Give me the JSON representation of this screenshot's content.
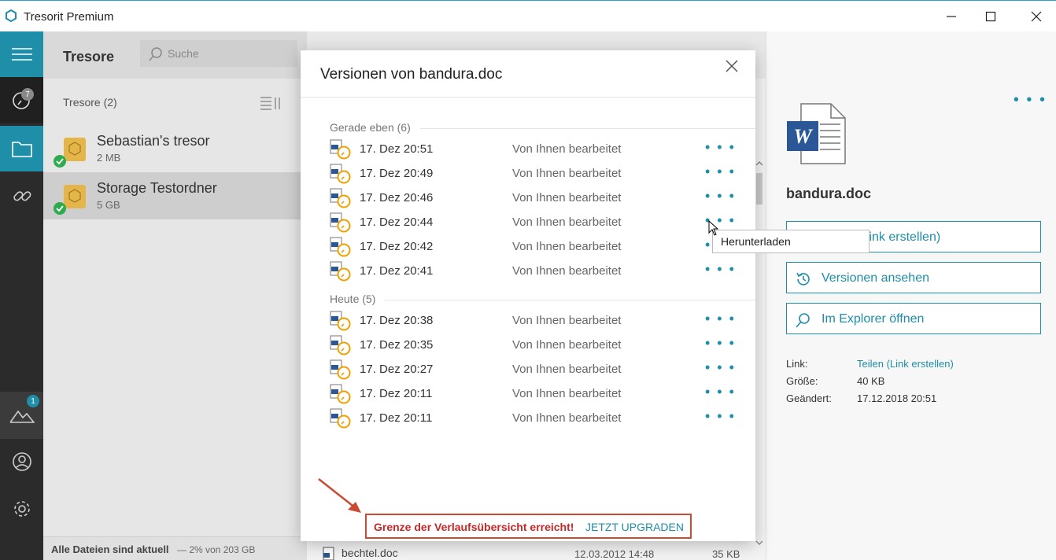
{
  "window": {
    "title": "Tresorit Premium"
  },
  "sidebar": {
    "recents_badge": "7",
    "upgrade_badge": "1"
  },
  "panel": {
    "title": "Tresore",
    "search_placeholder": "Suche",
    "count": "Tresore (2)",
    "vaults": [
      {
        "name": "Sebastian's tresor",
        "size": "2 MB"
      },
      {
        "name": "Storage Testordner",
        "size": "5 GB"
      }
    ],
    "footer_status": "Alle Dateien sind aktuell",
    "footer_quota": "— 2% von 203 GB"
  },
  "background_file": {
    "name": "bechtel.doc",
    "date": "12.03.2012 14:48",
    "size": "35 KB"
  },
  "details": {
    "file_name": "bandura.doc",
    "btn_share": "Teilen (Link erstellen)",
    "btn_versions": "Versionen ansehen",
    "btn_explorer": "Im Explorer öffnen",
    "link_label": "Link:",
    "link_value": "Teilen (Link erstellen)",
    "size_label": "Größe:",
    "size_value": "40 KB",
    "changed_label": "Geändert:",
    "changed_value": "17.12.2018 20:51"
  },
  "dialog": {
    "title": "Versionen von bandura.doc",
    "groups": [
      {
        "label": "Gerade eben (6)",
        "rows": [
          {
            "date": "17. Dez 20:51",
            "by": "Von Ihnen bearbeitet"
          },
          {
            "date": "17. Dez 20:49",
            "by": "Von Ihnen bearbeitet"
          },
          {
            "date": "17. Dez 20:46",
            "by": "Von Ihnen bearbeitet"
          },
          {
            "date": "17. Dez 20:44",
            "by": "Von Ihnen bearbeitet"
          },
          {
            "date": "17. Dez 20:42",
            "by": "Von Ihnen bearbeitet"
          },
          {
            "date": "17. Dez 20:41",
            "by": "Von Ihnen bearbeitet"
          }
        ]
      },
      {
        "label": "Heute (5)",
        "rows": [
          {
            "date": "17. Dez 20:38",
            "by": "Von Ihnen bearbeitet"
          },
          {
            "date": "17. Dez 20:35",
            "by": "Von Ihnen bearbeitet"
          },
          {
            "date": "17. Dez 20:27",
            "by": "Von Ihnen bearbeitet"
          },
          {
            "date": "17. Dez 20:11",
            "by": "Von Ihnen bearbeitet"
          },
          {
            "date": "17. Dez 20:11",
            "by": "Von Ihnen bearbeitet"
          }
        ]
      }
    ],
    "more_glyph": "• • •",
    "tooltip": "Herunterladen",
    "limit_warning": "Grenze der Verlaufsübersicht erreicht!",
    "upgrade_link": "JETZT UPGRADEN"
  },
  "colors": {
    "accent": "#1f8ea8",
    "warning": "#c62828",
    "highlight_box": "#cc4a31"
  }
}
